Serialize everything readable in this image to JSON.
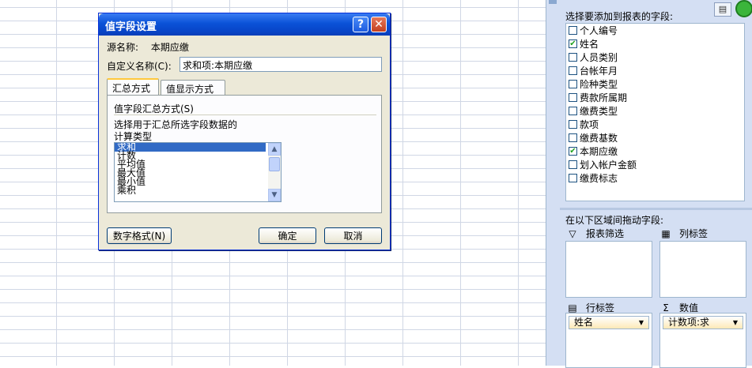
{
  "dialog": {
    "title": "值字段设置",
    "help_label": "?",
    "close_label": "✕",
    "source_label": "源名称:",
    "source_value": "本期应缴",
    "custom_name_label": "自定义名称(C):",
    "custom_name_value": "求和项:本期应缴",
    "tabs": [
      {
        "label": "汇总方式",
        "active": true
      },
      {
        "label": "值显示方式",
        "active": false
      }
    ],
    "summary_group_title": "值字段汇总方式(S)",
    "description_line1": "选择用于汇总所选字段数据的",
    "description_line2": "计算类型",
    "functions": [
      {
        "label": "求和",
        "selected": true
      },
      {
        "label": "计数",
        "selected": false
      },
      {
        "label": "平均值",
        "selected": false
      },
      {
        "label": "最大值",
        "selected": false
      },
      {
        "label": "最小值",
        "selected": false
      },
      {
        "label": "乘积",
        "selected": false
      }
    ],
    "number_format_button": "数字格式(N)",
    "ok_button": "确定",
    "cancel_button": "取消"
  },
  "pane": {
    "title": "选择要添加到报表的字段:",
    "fields": [
      {
        "label": "个人编号",
        "checked": false
      },
      {
        "label": "姓名",
        "checked": true
      },
      {
        "label": "人员类别",
        "checked": false
      },
      {
        "label": "台帐年月",
        "checked": false
      },
      {
        "label": "险种类型",
        "checked": false
      },
      {
        "label": "费款所属期",
        "checked": false
      },
      {
        "label": "缴费类型",
        "checked": false
      },
      {
        "label": "款项",
        "checked": false
      },
      {
        "label": "缴费基数",
        "checked": false
      },
      {
        "label": "本期应缴",
        "checked": true
      },
      {
        "label": "划入帐户金额",
        "checked": false
      },
      {
        "label": "缴费标志",
        "checked": false
      }
    ],
    "drag_title": "在以下区域间拖动字段:",
    "areas": {
      "report_filter": {
        "label": "报表筛选",
        "icon": "filter-icon"
      },
      "column_labels": {
        "label": "列标签",
        "icon": "columns-icon"
      },
      "row_labels": {
        "label": "行标签",
        "icon": "rows-icon",
        "item": "姓名"
      },
      "values": {
        "label": "数值",
        "icon": "sigma-icon",
        "item": "计数项:求"
      }
    }
  }
}
